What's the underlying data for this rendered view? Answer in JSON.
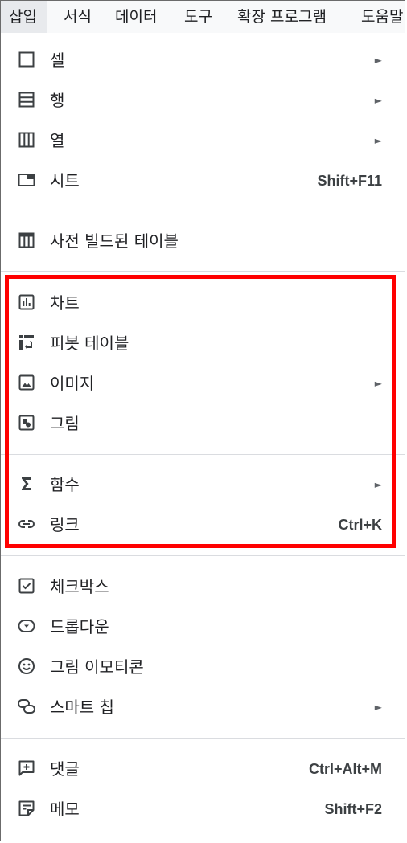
{
  "menubar": {
    "items": [
      "삽입",
      "서식",
      "데이터",
      "도구",
      "확장 프로그램",
      "도움말"
    ]
  },
  "menu": {
    "cell": {
      "label": "셀",
      "icon": "cell-icon"
    },
    "row": {
      "label": "행",
      "icon": "row-icon"
    },
    "column": {
      "label": "열",
      "icon": "column-icon"
    },
    "sheet": {
      "label": "시트",
      "shortcut": "Shift+F11",
      "icon": "sheet-icon"
    },
    "prebuilt_table": {
      "label": "사전 빌드된 테이블",
      "icon": "table-icon"
    },
    "chart": {
      "label": "차트",
      "icon": "chart-icon"
    },
    "pivot_table": {
      "label": "피봇 테이블",
      "icon": "pivot-table-icon"
    },
    "image": {
      "label": "이미지",
      "icon": "image-icon"
    },
    "drawing": {
      "label": "그림",
      "icon": "drawing-icon"
    },
    "function": {
      "label": "함수",
      "icon": "sigma-icon"
    },
    "link": {
      "label": "링크",
      "shortcut": "Ctrl+K",
      "icon": "link-icon"
    },
    "checkbox": {
      "label": "체크박스",
      "icon": "checkbox-icon"
    },
    "dropdown": {
      "label": "드롭다운",
      "icon": "dropdown-icon"
    },
    "emoji": {
      "label": "그림 이모티콘",
      "icon": "emoji-icon"
    },
    "smart_chip": {
      "label": "스마트 칩",
      "icon": "smart-chip-icon"
    },
    "comment": {
      "label": "댓글",
      "shortcut": "Ctrl+Alt+M",
      "icon": "comment-icon"
    },
    "note": {
      "label": "메모",
      "shortcut": "Shift+F2",
      "icon": "note-icon"
    }
  },
  "submenu_arrow": "►",
  "colors": {
    "highlight": "#ff0000",
    "icon": "#3c4043",
    "divider": "#dadce0"
  }
}
